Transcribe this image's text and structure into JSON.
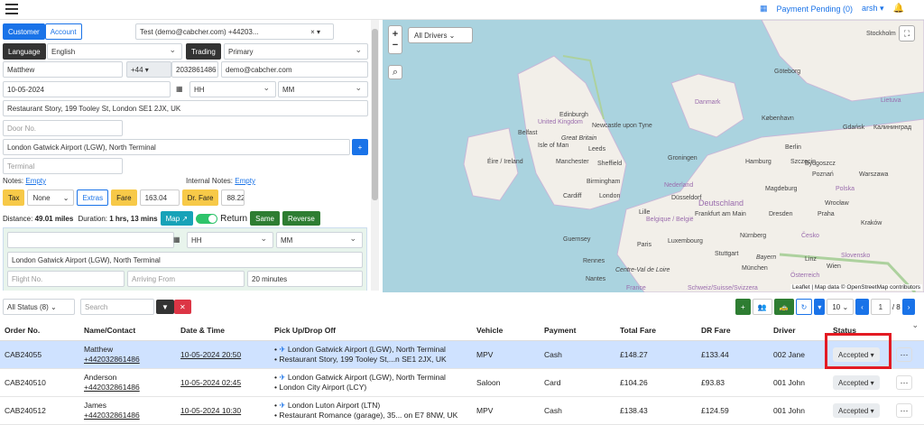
{
  "topbar": {
    "payment_pending": "Payment Pending (0)",
    "user": "arsh"
  },
  "booking": {
    "tab_customer": "Customer",
    "tab_account": "Account",
    "account_select": "Test (demo@cabcher.com) +44203...",
    "language_label": "Language",
    "language_value": "English",
    "trading_label": "Trading",
    "trading_value": "Primary",
    "name": "Matthew",
    "phone_code": "+44",
    "phone": "2032861486",
    "email": "demo@cabcher.com",
    "date": "10-05-2024",
    "hh": "HH",
    "mm": "MM",
    "pickup": "Restaurant Story, 199 Tooley St, London SE1 2JX, UK",
    "door_placeholder": "Door No.",
    "dropoff": "London Gatwick Airport (LGW), North Terminal",
    "terminal_placeholder": "Terminal",
    "notes_label": "Notes:",
    "notes_value": "Empty",
    "internal_notes_label": "Internal Notes:",
    "internal_notes_value": "Empty",
    "tax_label": "Tax",
    "tax_value": "None",
    "extras": "Extras",
    "fare_label": "Fare",
    "fare_value": "163.04",
    "drfare_label": "Dr. Fare",
    "drfare_value": "88.22",
    "distance_label": "Distance:",
    "distance_value": "49.01 miles",
    "duration_label": "Duration:",
    "duration_value": "1 hrs, 13 mins",
    "map_btn": "Map",
    "return_label": "Return",
    "same_btn": "Same",
    "reverse_btn": "Reverse",
    "return_pickup": "London Gatwick Airport (LGW), North Terminal",
    "flight_placeholder": "Flight No.",
    "arriving_placeholder": "Arriving From",
    "wait_value": "20 minutes"
  },
  "map": {
    "drivers_select": "All Drivers",
    "attribution": "Leaflet | Map data © OpenStreetMap contributors",
    "labels": [
      "Edinburgh",
      "United Kingdom",
      "Newcastle upon Tyne",
      "Great Britain",
      "Belfast",
      "Isle of Man",
      "Leeds",
      "Éire / Ireland",
      "Manchester",
      "Sheffield",
      "Birmingham",
      "Cardiff",
      "London",
      "Guernsey",
      "Paris",
      "Rennes",
      "Nantes",
      "Centre-Val de Loire",
      "France",
      "Lille",
      "Belgique / België",
      "Luxembourg",
      "Nederland",
      "Groningen",
      "Düsseldorf",
      "Deutschland",
      "Frankfurt am Main",
      "Nürnberg",
      "Stuttgart",
      "München",
      "Schweiz/Suisse/Svizzera",
      "Österreich",
      "Bayern",
      "Hamburg",
      "Danmark",
      "København",
      "Göteborg",
      "Stockholm",
      "Berlin",
      "Magdeburg",
      "Dresden",
      "Praha",
      "Česko",
      "Szczecin",
      "Poznań",
      "Polska",
      "Warszawa",
      "Wrocław",
      "Kraków",
      "Gdańsk",
      "Lietuva",
      "Bydgoszcz",
      "Linz",
      "Slovensko",
      "Wien",
      "Калининград"
    ]
  },
  "toolbar": {
    "status_filter": "All Status (8)",
    "search_placeholder": "Search",
    "per_page": "10",
    "page": "1",
    "pages": "/ 8"
  },
  "table": {
    "headers": [
      "Order No.",
      "Name/Contact",
      "Date & Time",
      "Pick Up/Drop Off",
      "Vehicle",
      "Payment",
      "Total Fare",
      "DR Fare",
      "Driver",
      "Status"
    ],
    "rows": [
      {
        "order": "CAB24055",
        "name": "Matthew",
        "phone": "+442032861486",
        "datetime": "10-05-2024 20:50",
        "pickup": "London Gatwick Airport (LGW), North Terminal",
        "dropoff": "Restaurant Story, 199 Tooley St,...n SE1 2JX, UK",
        "vehicle": "MPV",
        "payment": "Cash",
        "total": "£148.27",
        "dr": "£133.44",
        "driver": "002 Jane",
        "status": "Accepted"
      },
      {
        "order": "CAB240510",
        "name": "Anderson",
        "phone": "+442032861486",
        "datetime": "10-05-2024 02:45",
        "pickup": "London Gatwick Airport (LGW), North Terminal",
        "dropoff": "London City Airport (LCY)",
        "vehicle": "Saloon",
        "payment": "Card",
        "total": "£104.26",
        "dr": "£93.83",
        "driver": "001 John",
        "status": "Accepted"
      },
      {
        "order": "CAB240512",
        "name": "James",
        "phone": "+442032861486",
        "datetime": "10-05-2024 10:30",
        "pickup": "London Luton Airport (LTN)",
        "dropoff": "Restaurant Romance (garage), 35... on E7 8NW, UK",
        "vehicle": "MPV",
        "payment": "Cash",
        "total": "£138.43",
        "dr": "£124.59",
        "driver": "001 John",
        "status": "Accepted"
      }
    ]
  }
}
